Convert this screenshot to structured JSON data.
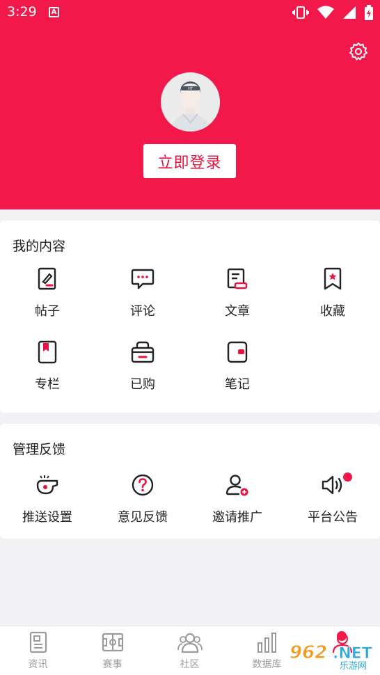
{
  "status_bar": {
    "time": "3:29"
  },
  "header": {
    "login_label": "立即登录"
  },
  "my_content": {
    "title": "我的内容",
    "items": [
      {
        "label": "帖子",
        "icon": "post-edit-icon"
      },
      {
        "label": "评论",
        "icon": "comment-icon"
      },
      {
        "label": "文章",
        "icon": "article-icon"
      },
      {
        "label": "收藏",
        "icon": "bookmark-star-icon"
      },
      {
        "label": "专栏",
        "icon": "column-book-icon"
      },
      {
        "label": "已购",
        "icon": "purchased-bag-icon"
      },
      {
        "label": "笔记",
        "icon": "note-icon"
      }
    ]
  },
  "feedback": {
    "title": "管理反馈",
    "items": [
      {
        "label": "推送设置",
        "icon": "whistle-icon"
      },
      {
        "label": "意见反馈",
        "icon": "question-circle-icon"
      },
      {
        "label": "邀请推广",
        "icon": "add-user-icon"
      },
      {
        "label": "平台公告",
        "icon": "speaker-icon",
        "has_badge": true
      }
    ]
  },
  "bottom_nav": [
    {
      "label": "资讯",
      "icon": "news-icon"
    },
    {
      "label": "赛事",
      "icon": "field-icon"
    },
    {
      "label": "社区",
      "icon": "community-icon"
    },
    {
      "label": "数据库",
      "icon": "bar-chart-icon"
    },
    {
      "label": "",
      "icon": "profile-icon"
    }
  ],
  "watermark": {
    "text": "962.NET",
    "sub": "乐游网"
  },
  "colors": {
    "accent": "#f2184a",
    "icon_stroke": "#222222",
    "icon_accent": "#e8113f",
    "nav_gray": "#9a9a9a"
  }
}
